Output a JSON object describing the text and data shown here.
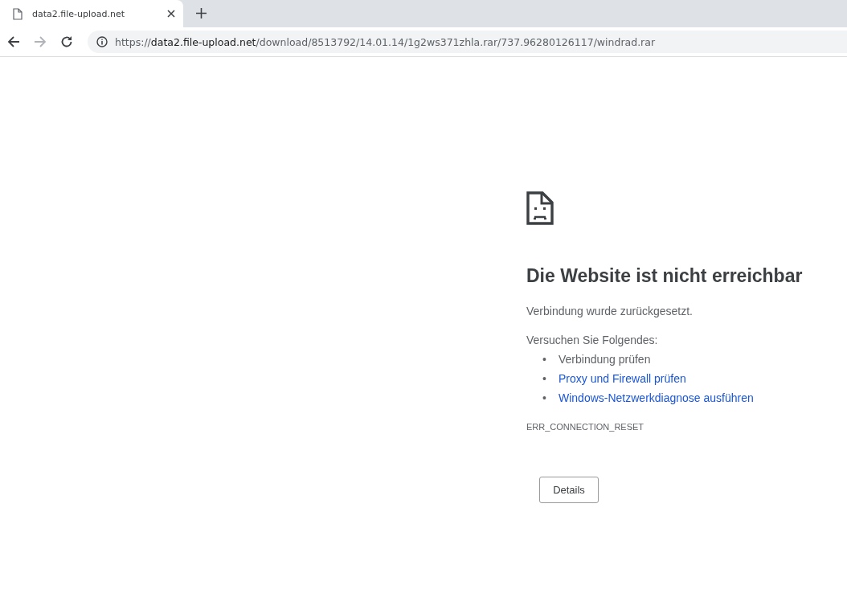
{
  "tab": {
    "title": "data2.file-upload.net",
    "selected": true
  },
  "toolbar": {
    "back_enabled": true,
    "forward_enabled": false
  },
  "address": {
    "scheme": "https://",
    "host": "data2.file-upload.net",
    "path": "/download/8513792/14.01.14/1g2ws371zhla.rar/737.96280126117/windrad.rar"
  },
  "error": {
    "heading": "Die Website ist nicht erreichbar",
    "message": "Verbindung wurde zurückgesetzt.",
    "suggestions_intro": "Versuchen Sie Folgendes:",
    "suggestions": [
      {
        "kind": "text",
        "bullet": "•",
        "text": "Verbindung prüfen"
      },
      {
        "kind": "link",
        "bullet": "•",
        "text": "Proxy und Firewall prüfen"
      },
      {
        "kind": "link",
        "bullet": "•",
        "text": "Windows-Netzwerkdiagnose ausführen"
      }
    ],
    "code": "ERR_CONNECTION_RESET",
    "details_button": "Details"
  }
}
